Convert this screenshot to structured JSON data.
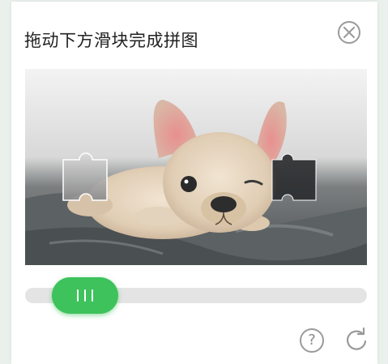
{
  "captcha": {
    "title": "拖动下方滑块完成拼图",
    "icons": {
      "close": "close-icon",
      "help": "help-icon",
      "refresh": "refresh-icon",
      "slider_grip": "grip-icon"
    },
    "help_symbol": "?",
    "image": {
      "subject": "french-bulldog-puppy-photo",
      "piece": "puzzle-piece",
      "target_hole": "puzzle-target-slot"
    },
    "colors": {
      "accent": "#3ec25c",
      "track": "#e4e4e4",
      "icon": "#9a9a9a"
    }
  }
}
